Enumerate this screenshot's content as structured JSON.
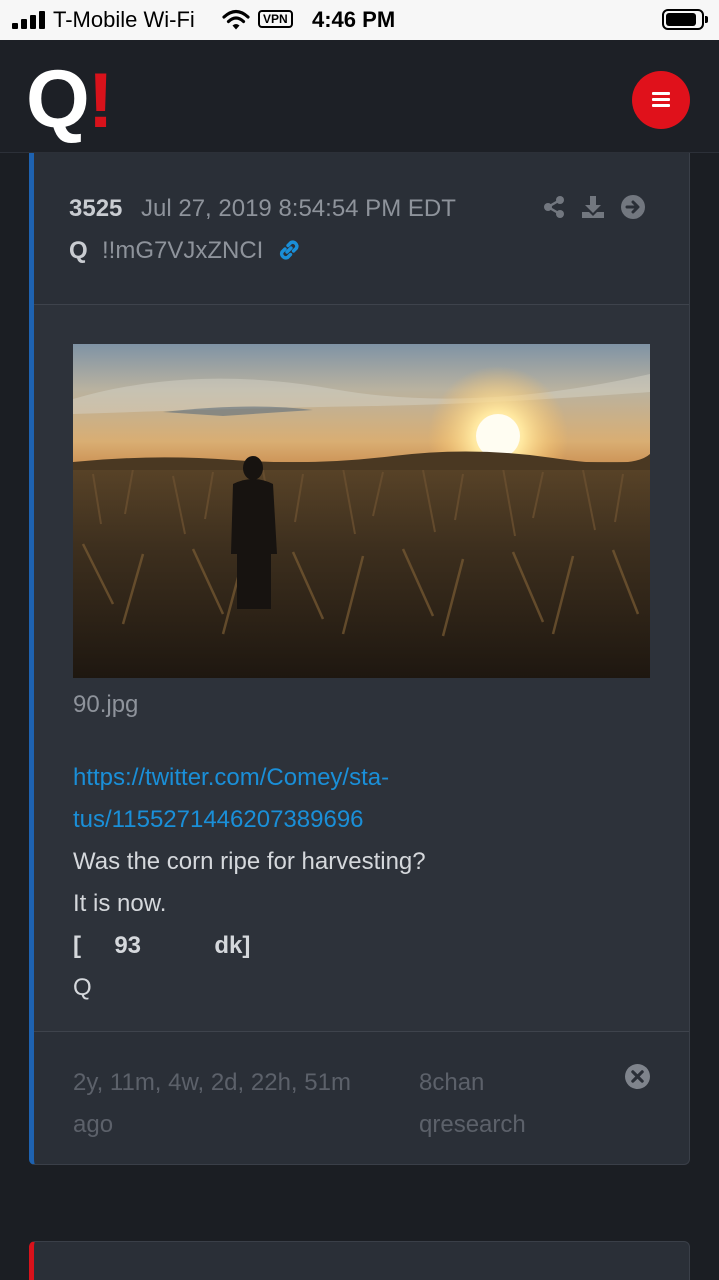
{
  "status_bar": {
    "carrier": "T-Mobile Wi-Fi",
    "vpn": "VPN",
    "time": "4:46 PM",
    "icons": [
      "signal-icon",
      "wifi-icon",
      "battery-icon"
    ]
  },
  "header": {
    "logo_q": "Q",
    "logo_bang": "!",
    "menu_icon": "hamburger-icon",
    "accent_color": "#e0111b"
  },
  "post": {
    "number": "3525",
    "date": "Jul 27, 2019 8:54:54 PM EDT",
    "author": "Q",
    "tripcode": "!!mG7VJxZNCI",
    "actions": [
      "share-icon",
      "download-icon",
      "arrow-right-circle-icon"
    ],
    "image_filename": "90.jpg",
    "link_line1": "https://twitter.com/Comey/sta-",
    "link_line2": "tus/1155271446207389696",
    "text_line1": "Was the corn ripe for harvesting?",
    "text_line2": "It is now.",
    "bracket_line": "[     93           dk]",
    "signature": "Q",
    "ago_line1": "2y, 11m, 4w, 2d, 22h, 51m",
    "ago_line2": "ago",
    "source_line1": "8chan",
    "source_line2": "qresearch",
    "border_color": "#1e62b0",
    "link_color": "#1a8fd8"
  }
}
